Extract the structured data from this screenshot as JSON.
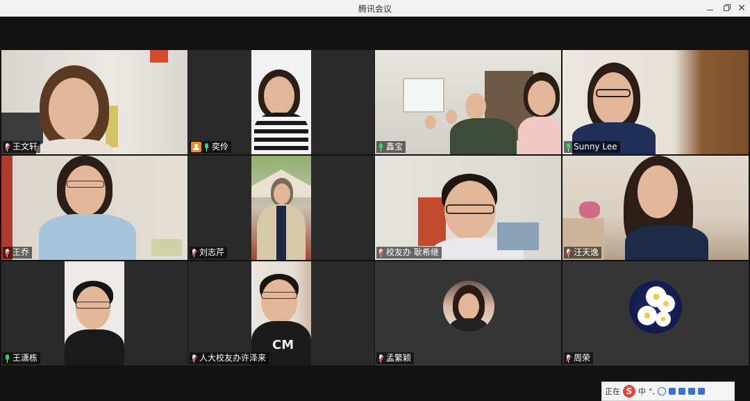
{
  "window": {
    "title": "腾讯会议"
  },
  "participants": [
    {
      "name": "王文轩",
      "mic": "muted"
    },
    {
      "name": "奕伶",
      "mic": "on",
      "host": true
    },
    {
      "name": "鑫宝",
      "mic": "on",
      "active": true
    },
    {
      "name": "Sunny Lee",
      "mic": "on"
    },
    {
      "name": "王乔",
      "mic": "muted"
    },
    {
      "name": "刘志芹",
      "mic": "muted"
    },
    {
      "name": "校友办 耿希继",
      "mic": "muted"
    },
    {
      "name": "汪天逸",
      "mic": "muted"
    },
    {
      "name": "王潇栋",
      "mic": "on"
    },
    {
      "name": "人大校友办许泽来",
      "mic": "muted"
    },
    {
      "name": "孟繁颖",
      "mic": "muted"
    },
    {
      "name": "周荣",
      "mic": "muted"
    }
  ],
  "ime": {
    "status": "正在",
    "mode": "中"
  },
  "colors": {
    "active_border": "#2fb36b",
    "host_badge": "#f08b2b",
    "mic_on": "#3ccf6e",
    "mic_muted": "#e23b3b"
  }
}
